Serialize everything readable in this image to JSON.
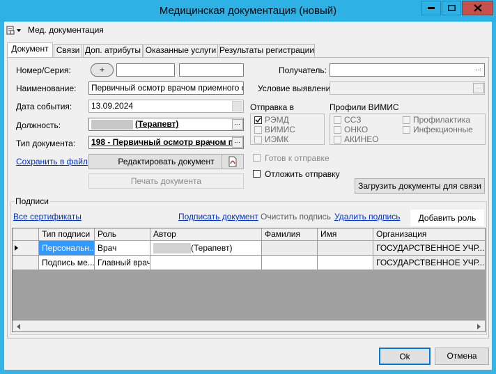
{
  "window": {
    "title": "Медицинская документация (новый)",
    "buttons": {
      "minimize": "minimize",
      "maximize": "maximize",
      "close": "close"
    },
    "accent": "#2eb2e6"
  },
  "toolbar": {
    "menu_label": "Мед. документация"
  },
  "tabs": [
    {
      "label": "Документ",
      "active": true
    },
    {
      "label": "Связи"
    },
    {
      "label": "Доп. атрибуты"
    },
    {
      "label": "Оказанные услуги"
    },
    {
      "label": "Результаты регистрации"
    }
  ],
  "form": {
    "number_label": "Номер/Серия:",
    "plus_button": "+",
    "number_value": "",
    "series_value": "",
    "name_label": "Наименование:",
    "name_value": "Первичный осмотр врачом приемного отде",
    "date_label": "Дата события:",
    "date_value": "13.09.2024",
    "position_label": "Должность:",
    "position_value": "(Терапевт)",
    "doctype_label": "Тип документа:",
    "doctype_value": "198 - Первичный осмотр врачом п",
    "recipient_label": "Получатель:",
    "recipient_value": "",
    "condition_label": "Условие выявления:",
    "condition_value": "",
    "save_link": "Сохранить в файл",
    "edit_button": "Редактировать документ",
    "print_button": "Печать документа",
    "load_docs_button": "Загрузить документы для связи"
  },
  "send_to": {
    "label": "Отправка в",
    "items": [
      {
        "label": "РЭМД",
        "checked": true
      },
      {
        "label": "ВИМИС",
        "checked": false
      },
      {
        "label": "ИЭМК",
        "checked": false
      }
    ]
  },
  "vimis_profiles": {
    "label": "Профили ВИМИС",
    "items": [
      {
        "label": "ССЗ"
      },
      {
        "label": "ОНКО"
      },
      {
        "label": "АКИНЕО"
      },
      {
        "label": "Профилактика"
      },
      {
        "label": "Инфекционные"
      }
    ]
  },
  "ready_label": "Готов к отправке",
  "defer_label": "Отложить отправку",
  "signatures": {
    "group_label": "Подписи",
    "all_certs_link": "Все сертификаты",
    "sign_link": "Подписать документ",
    "clear_label": "Очистить подпись",
    "delete_link": "Удалить подпись",
    "add_role_button": "Добавить роль",
    "columns": [
      "Тип подписи",
      "Роль",
      "Автор",
      "Фамилия",
      "Имя",
      "Организация"
    ],
    "rows": [
      {
        "type": "Персональн...",
        "role": "Врач",
        "author": "(Терапевт)",
        "last_name": "",
        "first_name": "",
        "org": "ГОСУДАРСТВЕННОЕ УЧР..."
      },
      {
        "type": "Подпись ме...",
        "role": "Главный врач",
        "author": "",
        "last_name": "",
        "first_name": "",
        "org": "ГОСУДАРСТВЕННОЕ УЧР..."
      }
    ]
  },
  "footer": {
    "ok_button": "Ok",
    "cancel_button": "Отмена"
  }
}
